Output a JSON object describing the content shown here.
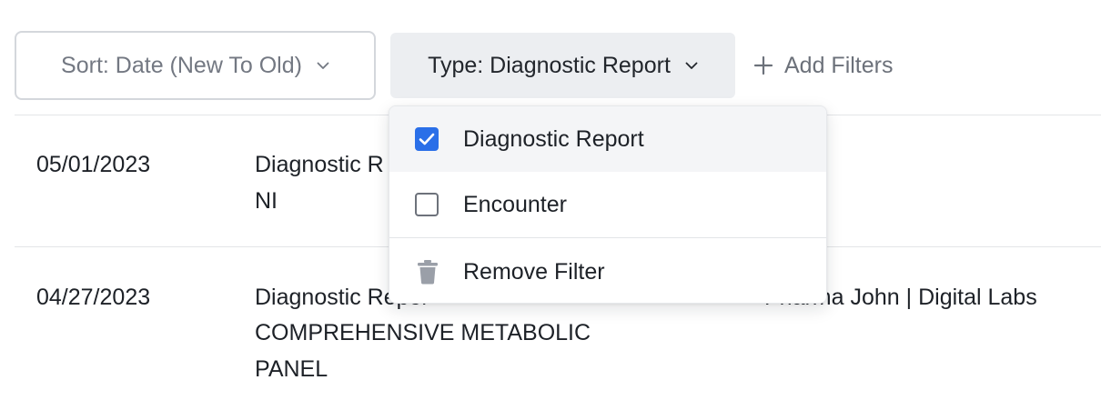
{
  "toolbar": {
    "sort_label": "Sort: Date (New To Old)",
    "type_label": "Type: Diagnostic Report",
    "add_filters_label": "Add Filters"
  },
  "rows": [
    {
      "date": "05/01/2023",
      "description": "Diagnostic R",
      "description_line2": "NI",
      "source": ""
    },
    {
      "date": "04/27/2023",
      "description": "Diagnostic Repor",
      "description_line2": "COMPREHENSIVE METABOLIC",
      "description_line3": "PANEL",
      "source": "Pharma John | Digital Labs"
    }
  ],
  "type_dropdown": {
    "options": [
      {
        "label": "Diagnostic Report",
        "checked": true
      },
      {
        "label": "Encounter",
        "checked": false
      }
    ],
    "remove_label": "Remove Filter"
  },
  "colors": {
    "accent": "#2a6fe8",
    "muted_text": "#737882",
    "border": "#d4d7dc",
    "chip_bg": "#eceef1"
  },
  "icons": [
    "chevron-down-icon",
    "plus-icon",
    "check-icon",
    "trash-icon"
  ]
}
